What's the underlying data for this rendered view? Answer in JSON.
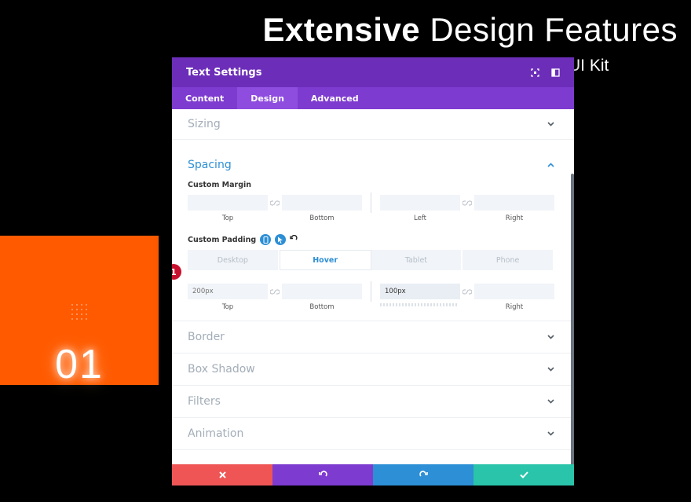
{
  "hero": {
    "title_bold": "Extensive",
    "title_light": "Design Features",
    "subtitle_fragment": "UI Kit"
  },
  "card": {
    "number": "01",
    "color": "#ff5a00"
  },
  "modal": {
    "title": "Text Settings",
    "tabs": [
      "Content",
      "Design",
      "Advanced"
    ],
    "active_tab": "Design",
    "sections": {
      "sizing": "Sizing",
      "spacing": "Spacing",
      "border": "Border",
      "box_shadow": "Box Shadow",
      "filters": "Filters",
      "animation": "Animation"
    },
    "custom_margin": {
      "label": "Custom Margin",
      "labels": [
        "Top",
        "Bottom",
        "Left",
        "Right"
      ],
      "values": [
        "",
        "",
        "",
        ""
      ]
    },
    "custom_padding": {
      "label": "Custom Padding",
      "device_tabs": [
        "Desktop",
        "Hover",
        "Tablet",
        "Phone"
      ],
      "active_device": "Hover",
      "labels": [
        "Top",
        "Bottom",
        "",
        "Right"
      ],
      "placeholders": [
        "200px",
        "",
        "",
        ""
      ],
      "values": [
        "",
        "",
        "100px",
        ""
      ]
    },
    "badge_number": "1"
  },
  "colors": {
    "header": "#6c2eb9",
    "tabs": "#7e3bd0",
    "accent_blue": "#2d8fd5",
    "footer_cancel": "#ef5555",
    "footer_undo": "#7e3bd0",
    "footer_redo": "#2d8fd5",
    "footer_save": "#29c4a9"
  }
}
